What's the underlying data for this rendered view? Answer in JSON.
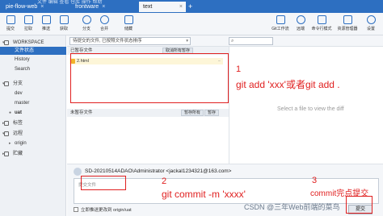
{
  "tabs": [
    {
      "label": "pie-flow-web",
      "active": false
    },
    {
      "label": "frontware",
      "active": false
    },
    {
      "label": "text",
      "active": true
    }
  ],
  "title_menu": [
    "文件",
    "编辑",
    "查看",
    "仓库",
    "操作",
    "帮助"
  ],
  "toolbar": {
    "left": [
      "提交",
      "拉取",
      "推送",
      "获取",
      "分支",
      "合并",
      "储藏"
    ],
    "right": [
      "Git工作流",
      "远端",
      "命令行模式",
      "资源管理器",
      "设置"
    ]
  },
  "sidebar": {
    "workspace": "WORKSPACE",
    "file_status": "文件状态",
    "history": "History",
    "search": "Search",
    "branches": "分支",
    "branch_items": [
      "dev",
      "master",
      "uat"
    ],
    "tags": "标签",
    "remotes": "远程",
    "remote_items": [
      "origin"
    ],
    "stashes": "贮藏"
  },
  "filter": {
    "value": "待提交的文件, 已按照文件状态排序",
    "placeholder": ""
  },
  "staged": {
    "title": "已暂存文件",
    "button": "取消所有暂存",
    "files": [
      "2.html"
    ]
  },
  "unstaged": {
    "title": "未暂存文件",
    "button_stage_all": "暂存所有",
    "button_stage": "暂存"
  },
  "diff_hint": "Select a file to view the diff",
  "commit": {
    "author": "SD-20210514ADAO\\Administrator <jackal1234321@163.com>",
    "message_placeholder": "提交文件",
    "push_label": "立即推送更改到 origin/uat",
    "button": "提交"
  },
  "annotations": {
    "n1": "1",
    "t1": "git add 'xxx'或者git add .",
    "n2": "2",
    "t2": "git commit -m 'xxxx'",
    "n3": "3",
    "t3": "commit完点提交"
  },
  "watermark": "CSDN @三年Web前端的菜鸟",
  "colors": {
    "accent": "#2d6fc1",
    "annotation": "#e02020",
    "staged_highlight": "#fdf6d8"
  }
}
